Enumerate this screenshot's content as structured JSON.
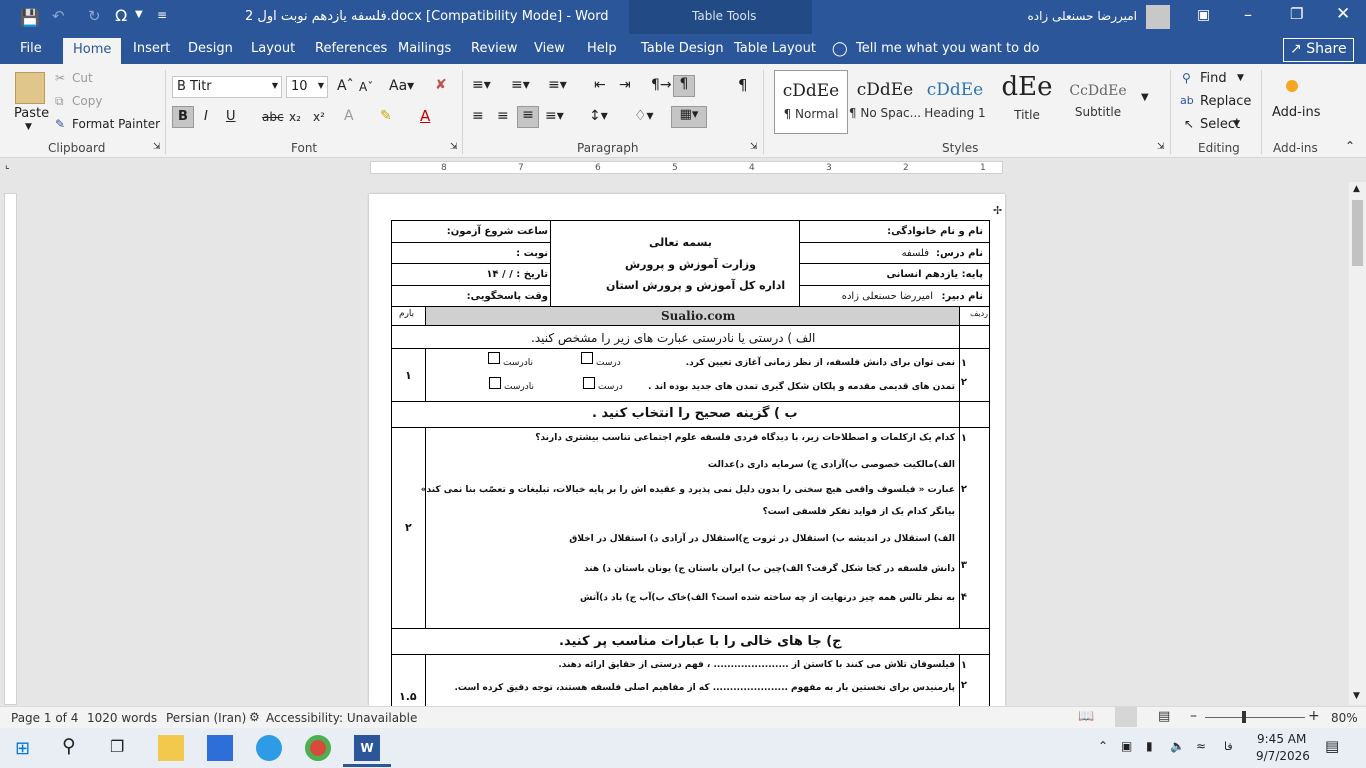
{
  "titlebar": {
    "doc_title": "فلسفه یازدهم نوبت اول 2.docx [Compatibility Mode] - Word",
    "context": "Table Tools",
    "user": "امیررضا حسنعلی زاده"
  },
  "tabs": [
    "File",
    "Home",
    "Insert",
    "Design",
    "Layout",
    "References",
    "Mailings",
    "Review",
    "View",
    "Help",
    "Table Design",
    "Table Layout"
  ],
  "tellme": "Tell me what you want to do",
  "share": "Share",
  "clipboard": {
    "paste": "Paste",
    "cut": "Cut",
    "copy": "Copy",
    "format_painter": "Format Painter",
    "group": "Clipboard"
  },
  "font": {
    "name": "B Titr",
    "size": "10",
    "group": "Font"
  },
  "paragraph": {
    "group": "Paragraph"
  },
  "styles": {
    "group": "Styles",
    "items": [
      {
        "sample": "cDdEe",
        "name": "¶ Normal"
      },
      {
        "sample": "cDdEe",
        "name": "¶ No Spac..."
      },
      {
        "sample": "cDdEe",
        "name": "Heading 1"
      },
      {
        "sample": "dEe",
        "name": "Title"
      },
      {
        "sample": "CcDdEe",
        "name": "Subtitle"
      }
    ]
  },
  "editing": {
    "find": "Find",
    "replace": "Replace",
    "select": "Select",
    "group": "Editing"
  },
  "addins": {
    "label": "Add-ins",
    "group": "Add-ins"
  },
  "ruler": {
    "numbers": [
      "8",
      "7",
      "6",
      "5",
      "4",
      "3",
      "2",
      "1"
    ]
  },
  "doc": {
    "hdr": {
      "name": "نام و نام خانوادگی:",
      "subject": "نام درس:",
      "subject_val": "فلسفه",
      "grade": "پایه: یازدهم انسانی",
      "teacher": "نام دبیر:",
      "teacher_val": "امیررضا حسنعلی زاده",
      "bism": "بسمه تعالی",
      "ministry": "وزارت آموزش و پرورش",
      "office": "اداره کل آموزش و پرورش استان",
      "start": "ساعت شروع آزمون:",
      "session": "نوبت :",
      "date": "تاریخ : / / ۱۴",
      "duration": "وقت پاسخگویی:"
    },
    "col_row": "ردیف",
    "site": "Sualio.com",
    "col_score": "بارم",
    "secA": "الف ) درستی یا نادرستی عبارت های زیر را مشخص کنید.",
    "a1": "نمی توان برای دانش فلسفه، از نظر زمانی آغازی تعیین کرد.",
    "a2": "تمدن های قدیمی مقدمه و پلکان شکل گیری تمدن های جدید بوده اند .",
    "true": "درست",
    "false": "نادرست",
    "n1": "۱",
    "n2": "۲",
    "n3": "۳",
    "n4": "۴",
    "scoreA": "۱",
    "secB": "ب ) گزینه صحیح را انتخاب کنید .",
    "b1": "کدام یک ازکلمات و اصطلاحات زیر، با دیدگاه فردی فلسفه علوم اجتماعی  تناسب بیشتری دارند؟",
    "b1o": "الف)مالکیت خصوصی    ب)آزادی    ج) سرمایه داری    د)عدالت",
    "b2a": "عبارت « فیلسوف واقعی هیچ سخنی را بدون دلیل نمی پذیرد و عقیده اش را بر پایه خیالات، تبلیغات و تعصّب بنا نمی کند»",
    "b2b": "بیانگر کدام یک از فواید تفکر فلسفی است؟",
    "b2o": "الف) استقلال در اندیشه    ب) استقلال در ثروت    ج)استقلال در آزادی    د) استقلال در اخلاق",
    "b3": "دانش فلسفه در کجا شکل گرفت؟     الف)چین    ب) ایران باستان    ج) یونان باستان    د) هند",
    "b4": "به نظر تالس همه چیز درنهایت از چه ساخته شده است؟     الف)خاک    ب)آب    ج) باد    د)آتش",
    "scoreB": "۲",
    "secC": "ج) جا های خالی را با عبارات مناسب پر کنید.",
    "c1": "فیلسوفان تلاش می کنند با کاستن از ...................... ، فهم درستی از حقایق ارائه دهند.",
    "c2": "پارمنیدس برای نخستین بار به مفهوم ...................... که از مفاهیم اصلی فلسفه هستند، توجه دقیق کرده است.",
    "scoreC": "۱.۵"
  },
  "status": {
    "page": "Page 1 of 4",
    "words": "1020 words",
    "lang": "Persian (Iran)",
    "access": "Accessibility: Unavailable",
    "zoom": "80%"
  },
  "taskbar": {
    "time": "9:45 AM",
    "date": "9/7/2026",
    "lang": "فا"
  }
}
